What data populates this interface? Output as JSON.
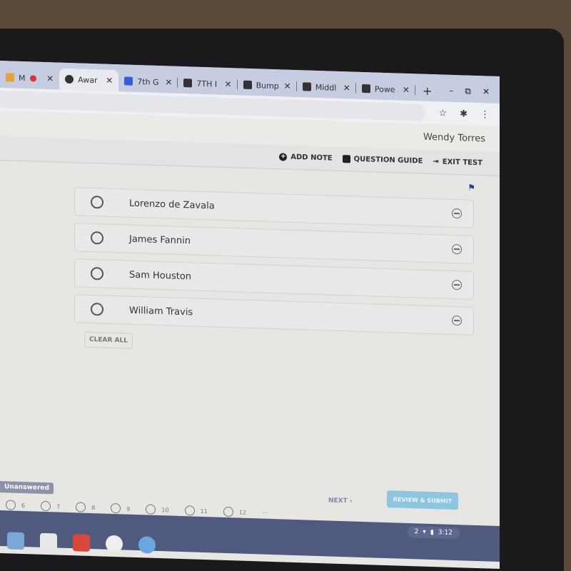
{
  "browser": {
    "tabs": [
      {
        "label": "M",
        "icon": "gmail-icon",
        "recording": true
      },
      {
        "label": "Awar",
        "icon": "globe-icon",
        "active": true
      },
      {
        "label": "7th G",
        "icon": "classroom-icon"
      },
      {
        "label": "7TH I",
        "icon": "classroom-icon"
      },
      {
        "label": "Bump",
        "icon": "classroom-icon"
      },
      {
        "label": "Middl",
        "icon": "classroom-icon"
      },
      {
        "label": "Powe",
        "icon": "classroom-icon"
      }
    ],
    "new_tab": "+",
    "close_glyph": "✕",
    "win_min": "–",
    "win_restore": "⧉",
    "win_close": "✕",
    "star": "☆",
    "ext": "✱",
    "menu": "⋮"
  },
  "user": {
    "name": "Wendy Torres"
  },
  "toolbar": {
    "add_note": "ADD NOTE",
    "question_guide": "QUESTION GUIDE",
    "exit_test": "EXIT TEST"
  },
  "flag": "⚑",
  "options": [
    {
      "label": "Lorenzo de Zavala"
    },
    {
      "label": "James Fannin"
    },
    {
      "label": "Sam Houston"
    },
    {
      "label": "William Travis"
    }
  ],
  "clear_all": "CLEAR ALL",
  "footer": {
    "tooltip": "Unanswered",
    "questions": [
      "6",
      "7",
      "8",
      "9",
      "10",
      "11",
      "12"
    ],
    "more": "...",
    "next": "NEXT  ›",
    "submit": "REVIEW & SUBMIT"
  },
  "shelf": {
    "time": "3:12",
    "notif": "2"
  }
}
